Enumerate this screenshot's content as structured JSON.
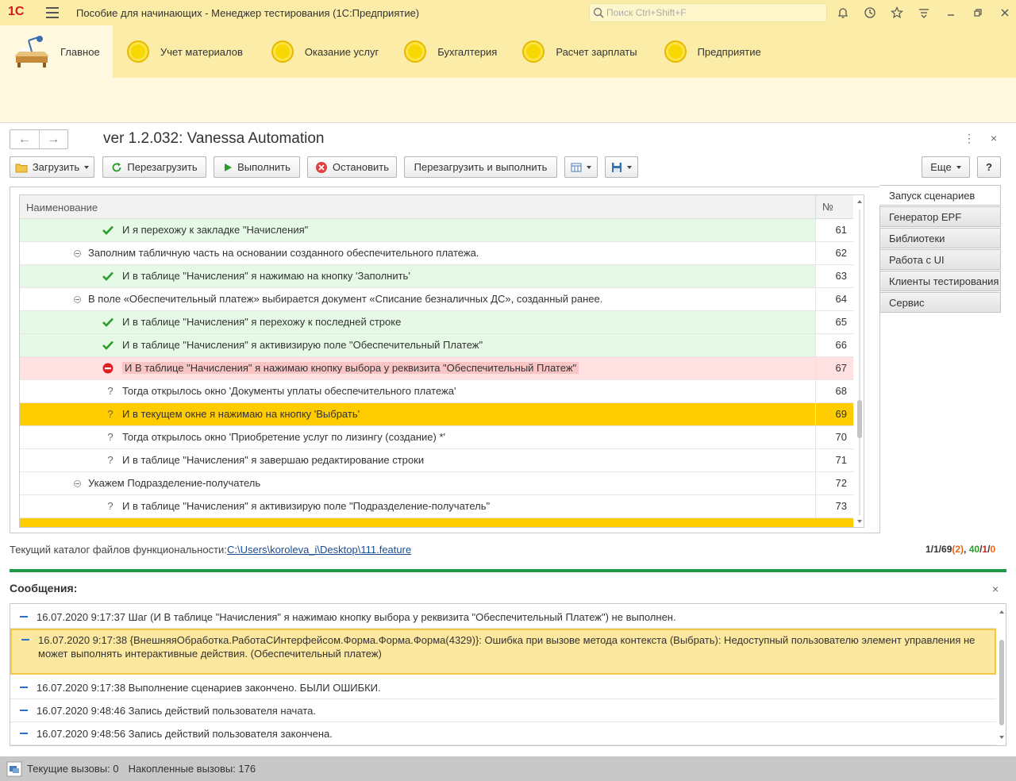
{
  "titlebar": {
    "logo": "1С",
    "title": "Пособие для начинающих  - Менеджер тестирования (1С:Предприятие)",
    "search_placeholder": "Поиск Ctrl+Shift+F"
  },
  "sections": [
    {
      "label": "Главное",
      "active": true
    },
    {
      "label": "Учет материалов"
    },
    {
      "label": "Оказание услуг"
    },
    {
      "label": "Бухгалтерия"
    },
    {
      "label": "Расчет зарплаты"
    },
    {
      "label": "Предприятие"
    }
  ],
  "form": {
    "title": "ver 1.2.032: Vanessa Automation",
    "menu_icon": "⋮",
    "close_icon": "×"
  },
  "toolbar": {
    "load": "Загрузить",
    "reload": "Перезагрузить",
    "run": "Выполнить",
    "stop": "Остановить",
    "reload_run": "Перезагрузить и выполнить",
    "more": "Еще",
    "help": "?"
  },
  "grid": {
    "col_name": "Наименование",
    "col_num": "№",
    "rows": [
      {
        "status": "ok",
        "indent": 2,
        "text": "И я перехожу к закладке \"Начисления\"",
        "num": "61"
      },
      {
        "status": "group",
        "indent": 1,
        "text": "Заполним табличную часть на основании созданного обеспечительного платежа.",
        "num": "62"
      },
      {
        "status": "ok",
        "indent": 2,
        "text": "И в таблице \"Начисления\" я нажимаю на кнопку 'Заполнить'",
        "num": "63"
      },
      {
        "status": "group",
        "indent": 1,
        "text": "В поле «Обеспечительный платеж» выбирается документ «Списание безналичных ДС», созданный ранее.",
        "num": "64"
      },
      {
        "status": "ok",
        "indent": 2,
        "text": "И в таблице \"Начисления\" я перехожу к последней строке",
        "num": "65"
      },
      {
        "status": "ok",
        "indent": 2,
        "text": "И в таблице \"Начисления\" я активизирую поле \"Обеспечительный Платеж\"",
        "num": "66"
      },
      {
        "status": "err",
        "indent": 2,
        "text": "И В таблице \"Начисления\" я нажимаю кнопку выбора у реквизита \"Обеспечительный Платеж\"",
        "num": "67"
      },
      {
        "status": "q",
        "indent": 2,
        "text": "Тогда открылось окно 'Документы уплаты обеспечительного платежа'",
        "num": "68"
      },
      {
        "status": "cur",
        "indent": 2,
        "text": "И в текущем окне я нажимаю на кнопку 'Выбрать'",
        "num": "69"
      },
      {
        "status": "q",
        "indent": 2,
        "text": "Тогда открылось окно 'Приобретение услуг по лизингу (создание) *'",
        "num": "70"
      },
      {
        "status": "q",
        "indent": 2,
        "text": "И в таблице \"Начисления\" я завершаю редактирование строки",
        "num": "71"
      },
      {
        "status": "group",
        "indent": 1,
        "text": "Укажем Подразделение-получатель",
        "num": "72"
      },
      {
        "status": "q",
        "indent": 2,
        "text": "И в таблице \"Начисления\" я активизирую поле \"Подразделение-получатель\"",
        "num": "73"
      }
    ]
  },
  "right_tabs": [
    {
      "label": "Запуск сценариев",
      "active": true
    },
    {
      "label": "Генератор EPF"
    },
    {
      "label": "Библиотеки"
    },
    {
      "label": "Работа с UI"
    },
    {
      "label": "Клиенты тестирования"
    },
    {
      "label": "Сервис"
    }
  ],
  "path": {
    "label": "Текущий каталог файлов функциональности:",
    "value": "C:\\Users\\koroleva_i\\Desktop\\111.feature"
  },
  "stats": {
    "a": "1/1/69",
    "b": "(2)",
    "sep": ", ",
    "ok": "40",
    "s1": "/",
    "err": "1",
    "s2": "/",
    "skip": "0",
    "colors": {
      "orange": "#e8641a",
      "green": "#2a9d2a",
      "red": "#d02020"
    }
  },
  "messages": {
    "title": "Сообщения:",
    "items": [
      {
        "text": "16.07.2020 9:17:37 Шаг (И В таблице \"Начисления\" я нажимаю кнопку выбора у реквизита \"Обеспечительный Платеж\") не выполнен."
      },
      {
        "text": "16.07.2020 9:17:38 {ВнешняяОбработка.РаботаСИнтерфейсом.Форма.Форма.Форма(4329)}: Ошибка при вызове метода контекста (Выбрать): Недоступный пользователю элемент управления не может выполнять интерактивные действия. (Обеспечительный платеж)",
        "highlight": true
      },
      {
        "text": "16.07.2020 9:17:38 Выполнение сценариев закончено. БЫЛИ ОШИБКИ."
      },
      {
        "text": "16.07.2020 9:48:46 Запись действий пользователя начата."
      },
      {
        "text": "16.07.2020 9:48:56 Запись действий пользователя закончена."
      }
    ]
  },
  "statusbar": {
    "current_calls": "Текущие вызовы: 0",
    "accumulated_calls": "Накопленные вызовы: 176"
  },
  "colors": {
    "brand_yellow": "#fbeda8",
    "ok_row": "#e6f9e6",
    "err_row": "#ffe1e1",
    "current_row": "#ffcc00",
    "divider_green": "#1f9947"
  }
}
